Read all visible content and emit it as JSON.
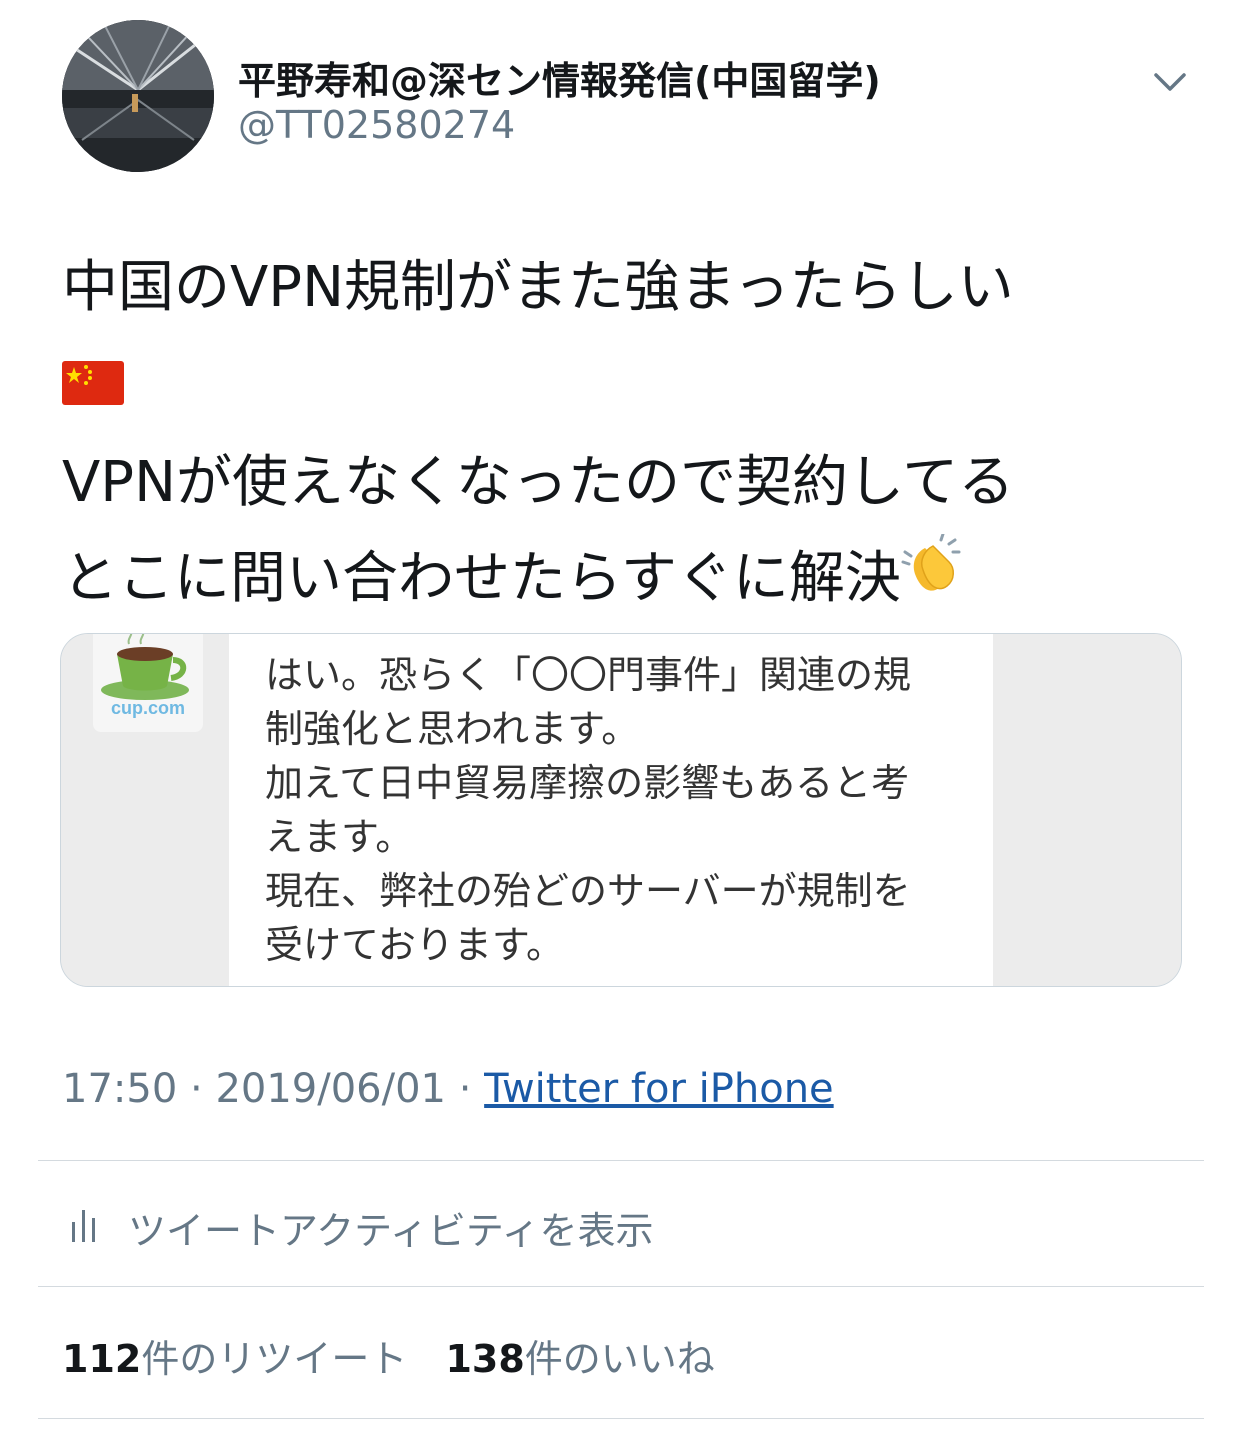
{
  "profile": {
    "display_name": "平野寿和@深セン情報発信(中国留学)",
    "handle": "@TT02580274",
    "avatar_icon": "avatar-photo"
  },
  "tweet": {
    "line1": "中国のVPN規制がまた強まったらしい",
    "line2_emoji": "china-flag-icon",
    "line3": "VPNが使えなくなったので契約してる",
    "line4": "とこに問い合わせたらすぐに解決",
    "line4_emoji": "clapping-hands-icon"
  },
  "media": {
    "logo_text": "cup.com",
    "message_lines": [
      "はい。恐らく「〇〇門事件」関連の規",
      "制強化と思われます。",
      "加えて日中貿易摩擦の影響もあると考",
      "えます。",
      "現在、弊社の殆どのサーバーが規制を",
      "受けております。"
    ]
  },
  "meta": {
    "time": "17:50",
    "separator": " · ",
    "date": "2019/06/01",
    "source": "Twitter for iPhone"
  },
  "activity": {
    "label": "ツイートアクティビティを表示",
    "icon": "analytics-bars-icon"
  },
  "stats": {
    "retweets_count": "112",
    "retweets_label": "件のリツイート",
    "likes_count": "138",
    "likes_label": "件のいいね"
  },
  "colors": {
    "text": "#14171a",
    "secondary": "#657786",
    "link": "#1b5aa6",
    "divider": "#d4dadf"
  }
}
